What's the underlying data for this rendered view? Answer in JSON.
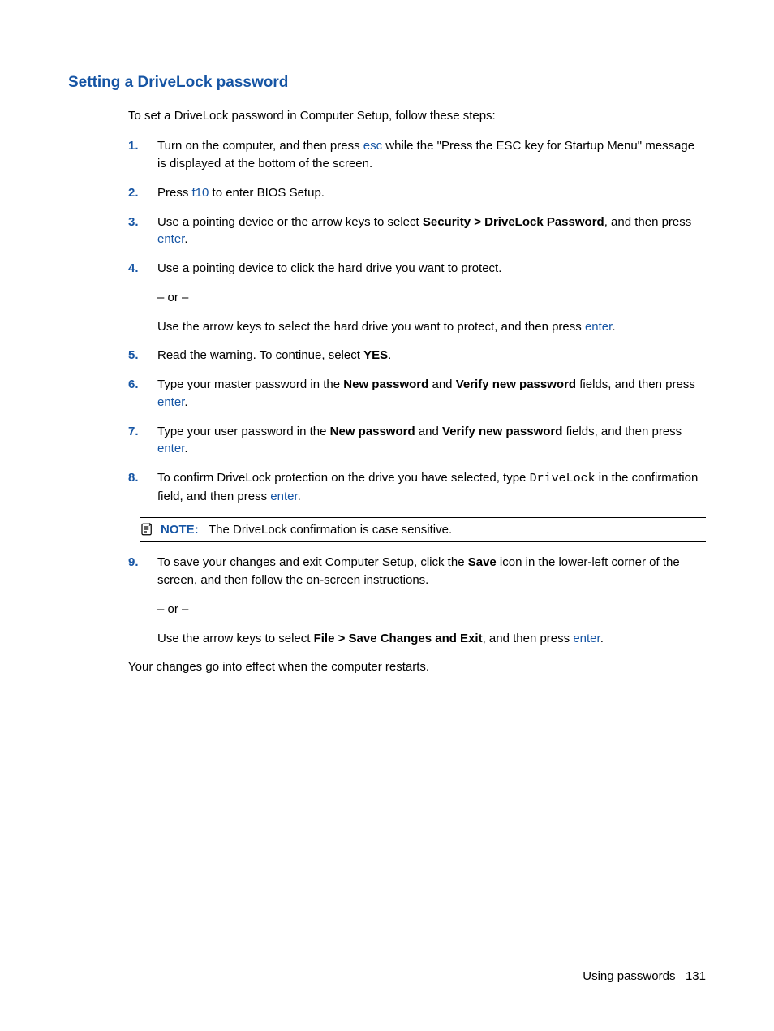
{
  "title": "Setting a DriveLock password",
  "intro": "To set a DriveLock password in Computer Setup, follow these steps:",
  "steps": [
    {
      "num": "1.",
      "pre1": "Turn on the computer, and then press ",
      "link1": "esc",
      "post1": " while the \"Press the ESC key for Startup Menu\" message is displayed at the bottom of the screen."
    },
    {
      "num": "2.",
      "pre1": "Press ",
      "link1": "f10",
      "post1": " to enter BIOS Setup."
    },
    {
      "num": "3.",
      "pre1": "Use a pointing device or the arrow keys to select ",
      "bold1": "Security > DriveLock Password",
      "post1": ", and then press ",
      "link2": "enter",
      "post2": "."
    },
    {
      "num": "4.",
      "para1": "Use a pointing device to click the hard drive you want to protect.",
      "or": "– or –",
      "pre2": "Use the arrow keys to select the hard drive you want to protect, and then press ",
      "link2": "enter",
      "post2": "."
    },
    {
      "num": "5.",
      "pre1": "Read the warning. To continue, select ",
      "bold1": "YES",
      "post1": "."
    },
    {
      "num": "6.",
      "pre1": "Type your master password in the ",
      "bold1": "New password",
      "mid1": " and ",
      "bold2": "Verify new password",
      "post1": " fields, and then press ",
      "link2": "enter",
      "post2": "."
    },
    {
      "num": "7.",
      "pre1": "Type your user password in the ",
      "bold1": "New password",
      "mid1": " and ",
      "bold2": "Verify new password",
      "post1": " fields, and then press ",
      "link2": "enter",
      "post2": "."
    },
    {
      "num": "8.",
      "pre1": "To confirm DriveLock protection on the drive you have selected, type ",
      "mono1": "DriveLock",
      "post1": " in the confirmation field, and then press ",
      "link2": "enter",
      "post2": "."
    },
    {
      "num": "9.",
      "pre1": "To save your changes and exit Computer Setup, click the ",
      "bold1": "Save",
      "post1": " icon in the lower-left corner of the screen, and then follow the on-screen instructions.",
      "or": "– or –",
      "pre2": "Use the arrow keys to select ",
      "bold3": "File > Save Changes and Exit",
      "mid2": ", and then press ",
      "link3": "enter",
      "post3": "."
    }
  ],
  "note": {
    "label": "NOTE:",
    "text": "The DriveLock confirmation is case sensitive."
  },
  "closing": "Your changes go into effect when the computer restarts.",
  "footer": {
    "section": "Using passwords",
    "page": "131"
  }
}
